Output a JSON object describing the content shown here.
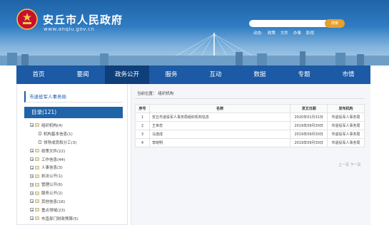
{
  "header": {
    "site_title": "安丘市人民政府",
    "site_url": "www.anqiu.gov.cn",
    "search_button": "搜索",
    "quicklinks": [
      "动态:",
      "政策",
      "文件",
      "办事",
      "影视"
    ]
  },
  "nav": {
    "items": [
      "首页",
      "要闻",
      "政务公开",
      "服务",
      "互动",
      "数据",
      "专题",
      "市情"
    ],
    "active_index": 2
  },
  "sidebar": {
    "title": "市退役军人事务局",
    "root": "目录(121)",
    "tree": [
      {
        "label": "组织机构(4)",
        "level": 0,
        "type": "folder"
      },
      {
        "label": "机构基本信息(1)",
        "level": 1,
        "type": "doc"
      },
      {
        "label": "领导成员和分工(3)",
        "level": 1,
        "type": "doc"
      },
      {
        "label": "政策文件(22)",
        "level": 0,
        "type": "folder"
      },
      {
        "label": "工作信息(44)",
        "level": 0,
        "type": "folder"
      },
      {
        "label": "人事信息(3)",
        "level": 0,
        "type": "folder"
      },
      {
        "label": "执法公开(1)",
        "level": 0,
        "type": "folder"
      },
      {
        "label": "管理公开(6)",
        "level": 0,
        "type": "folder"
      },
      {
        "label": "服务公开(2)",
        "level": 0,
        "type": "folder"
      },
      {
        "label": "其他信息(16)",
        "level": 0,
        "type": "folder"
      },
      {
        "label": "重点领域(23)",
        "level": 0,
        "type": "folder"
      },
      {
        "label": "市直部门财政预算(5)",
        "level": 0,
        "type": "folder"
      }
    ]
  },
  "content": {
    "breadcrumb": "当前位置： 组织机构",
    "table": {
      "headers": [
        "序号",
        "名称",
        "发文日期",
        "发布机构"
      ],
      "rows": [
        [
          "1",
          "安丘市退役军人事务局组织机构信息",
          "2020年01月31日",
          "市退役军人事务局"
        ],
        [
          "2",
          "王世忠",
          "2019年09月30日",
          "市退役军人事务局"
        ],
        [
          "3",
          "马连成",
          "2019年09月30日",
          "市退役军人事务局"
        ],
        [
          "4",
          "李晓明",
          "2019年09月30日",
          "市退役军人事务局"
        ]
      ]
    },
    "pager": "上一页 下一页"
  },
  "colors": {
    "nav_bg": "#1c5aa5",
    "nav_active": "#0f3f7a",
    "search_button": "#e8a02c"
  }
}
